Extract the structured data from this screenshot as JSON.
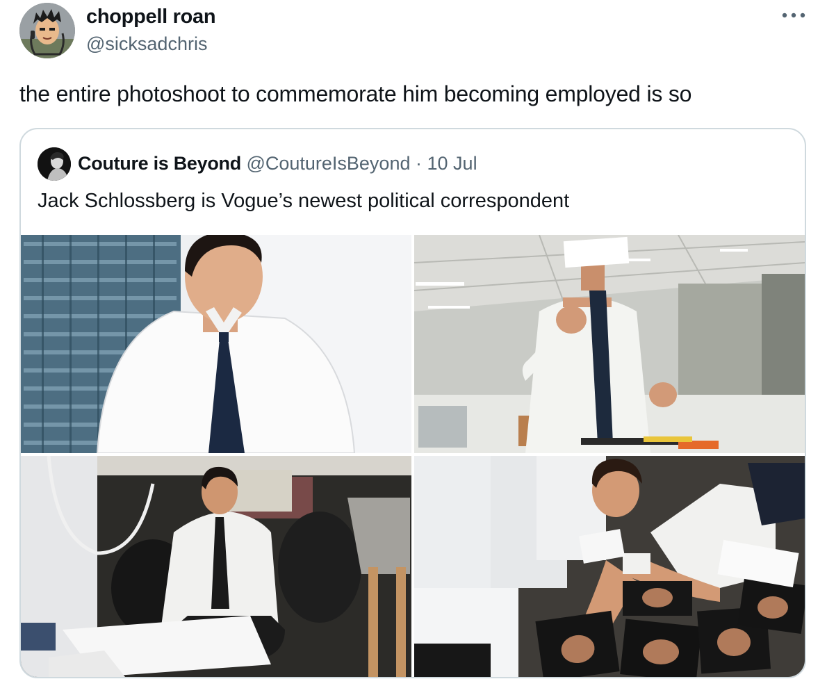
{
  "author": {
    "name": "choppell roan",
    "handle": "@sicksadchris",
    "avatar_icon": "cartoon-avatar"
  },
  "more_icon": "more-options-icon",
  "tweet": {
    "text": "the entire photoshoot to commemorate him becoming employed is so"
  },
  "quoted": {
    "name": "Couture is Beyond",
    "handle": "@CoutureIsBeyond",
    "separator": "·",
    "date": "10 Jul",
    "text": "Jack Schlossberg is Vogue’s newest political correspondent",
    "photos": [
      {
        "subject": "man in white shirt and navy tie by window"
      },
      {
        "subject": "man pointing, face hidden by paper, in office"
      },
      {
        "subject": "man crouching under desk holding pen"
      },
      {
        "subject": "man lying on carpet among printed photos"
      }
    ]
  },
  "colors": {
    "text_primary": "#0f1419",
    "text_secondary": "#536471",
    "border": "#cfd9de"
  }
}
